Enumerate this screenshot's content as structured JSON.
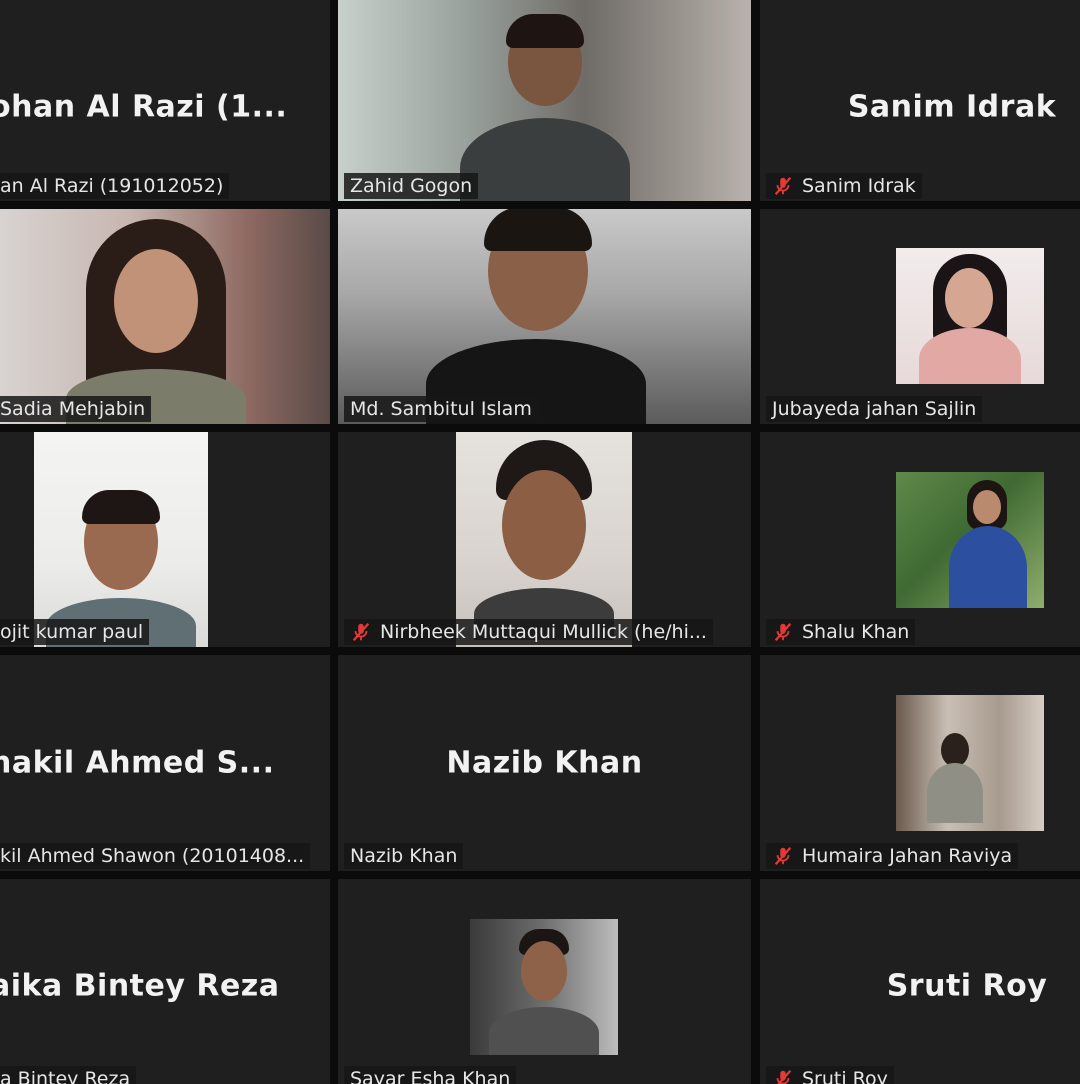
{
  "tiles": [
    {
      "id": "t1",
      "display_name": "ohan  Al  Razi  (1...",
      "label": "an Al Razi (191012052)",
      "muted": false,
      "video": false
    },
    {
      "id": "t2",
      "display_name": "",
      "label": "Zahid Gogon",
      "muted": false,
      "video": true
    },
    {
      "id": "t3",
      "display_name": "Sanim Idrak",
      "label": "Sanim Idrak",
      "muted": true,
      "video": false
    },
    {
      "id": "t4",
      "display_name": "",
      "label": "Sadia Mehjabin",
      "muted": false,
      "video": true
    },
    {
      "id": "t5",
      "display_name": "",
      "label": "Md. Sambitul Islam",
      "muted": false,
      "video": true
    },
    {
      "id": "t6",
      "display_name": "",
      "label": "Jubayeda jahan Sajlin",
      "muted": false,
      "video": false
    },
    {
      "id": "t7",
      "display_name": "",
      "label": "ojit kumar paul",
      "muted": false,
      "video": true
    },
    {
      "id": "t8",
      "display_name": "",
      "label": "Nirbheek Muttaqui Mullick (he/hi...",
      "muted": true,
      "video": true
    },
    {
      "id": "t9",
      "display_name": "",
      "label": "Shalu Khan",
      "muted": true,
      "video": false
    },
    {
      "id": "t10",
      "display_name": "hakil  Ahmed  S...",
      "label": "kil Ahmed Shawon (20101408...",
      "muted": false,
      "video": false
    },
    {
      "id": "t11",
      "display_name": "Nazib Khan",
      "label": "Nazib Khan",
      "muted": false,
      "video": false
    },
    {
      "id": "t12",
      "display_name": "",
      "label": "Humaira Jahan Raviya",
      "muted": true,
      "video": false
    },
    {
      "id": "t13",
      "display_name": "aika Bintey Reza",
      "label": "a Bintey Reza",
      "muted": false,
      "video": false
    },
    {
      "id": "t14",
      "display_name": "",
      "label": "Sayar Esha Khan",
      "muted": false,
      "video": true
    },
    {
      "id": "t15",
      "display_name": "Sruti Roy",
      "label": "Sruti Roy",
      "muted": true,
      "video": false
    }
  ],
  "colors": {
    "tile_bg": "#1f1f1f",
    "gap": "#0b0b0b",
    "mic_muted": "#e53935",
    "name_text": "#f2f2f2"
  }
}
